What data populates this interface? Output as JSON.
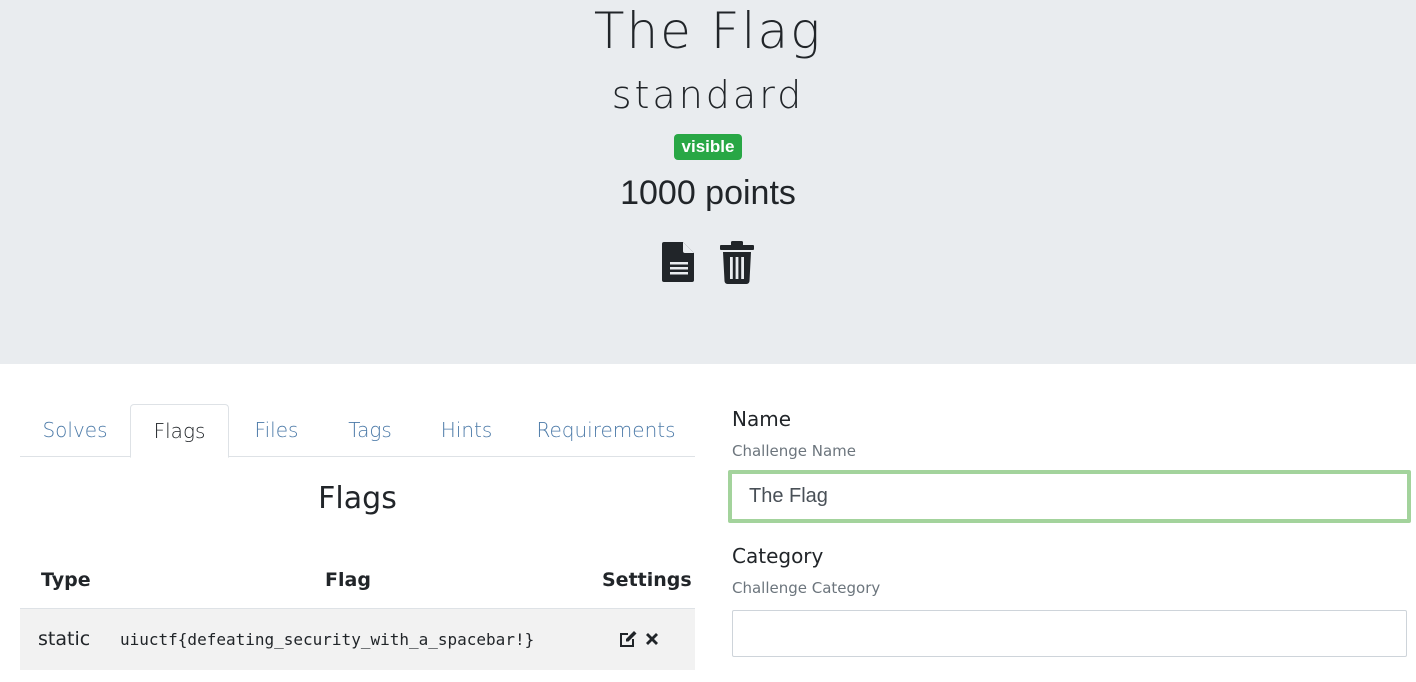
{
  "challenge": {
    "name": "The Flag",
    "type": "standard",
    "state": "visible",
    "value": "1000 points",
    "state_color": "#28a745"
  },
  "actions": {
    "edit_icon": "file-text-icon",
    "delete_icon": "trash-icon"
  },
  "tabs": [
    {
      "label": "Solves"
    },
    {
      "label": "Flags"
    },
    {
      "label": "Files"
    },
    {
      "label": "Tags"
    },
    {
      "label": "Hints"
    },
    {
      "label": "Requirements"
    }
  ],
  "active_tab": "Flags",
  "flags_section": {
    "heading": "Flags",
    "columns": {
      "type": "Type",
      "flag": "Flag",
      "settings": "Settings"
    },
    "rows": [
      {
        "type": "static",
        "flag": "uiuctf{defeating_security_with_a_spacebar!}",
        "icons": [
          "edit-icon",
          "close-icon"
        ]
      }
    ]
  },
  "form": {
    "name": {
      "label": "Name",
      "help": "Challenge Name",
      "value": "The Flag"
    },
    "category": {
      "label": "Category",
      "help": "Challenge Category",
      "value": ""
    }
  }
}
